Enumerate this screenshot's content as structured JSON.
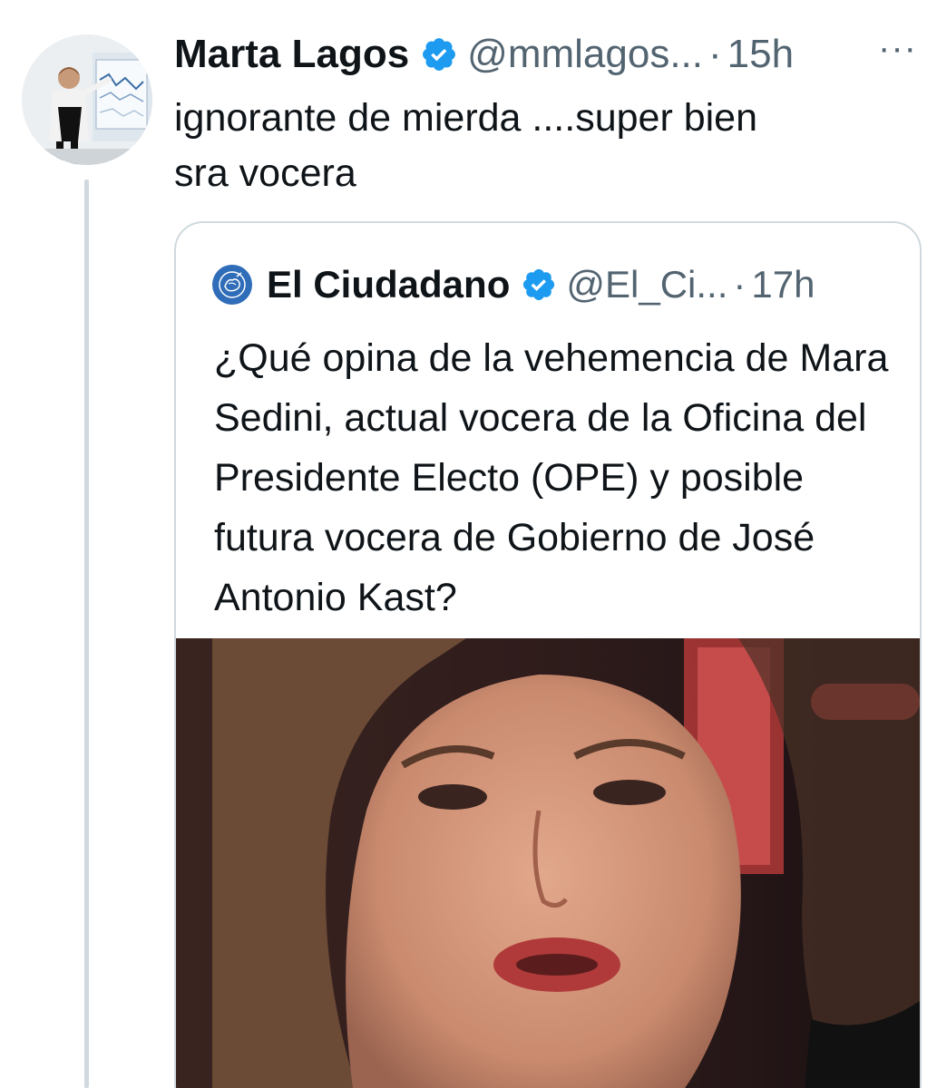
{
  "tweet": {
    "author_name": "Marta Lagos",
    "author_handle": "@mmlagos...",
    "separator": "·",
    "timestamp": "15h",
    "more_label": "···",
    "text": "ignorante de mierda ....super bien\nsra vocera",
    "avatar_icon": "profile-photo-icon",
    "verified_icon": "verified-badge-icon"
  },
  "quoted": {
    "author_name": "El Ciudadano",
    "author_handle": "@El_Ci...",
    "separator": "·",
    "timestamp": "17h",
    "text": "¿Qué opina de la vehemencia de Mara Sedini, actual vocera de la Oficina del Presidente Electo (OPE) y posible futura vocera de Gobierno de José Antonio Kast?",
    "logo_icon": "el-ciudadano-logo-icon",
    "media_icon": "video-thumbnail-image"
  },
  "colors": {
    "text_primary": "#0f1419",
    "text_secondary": "#536471",
    "verified_blue": "#1d9bf0",
    "border": "#cfd9de"
  }
}
